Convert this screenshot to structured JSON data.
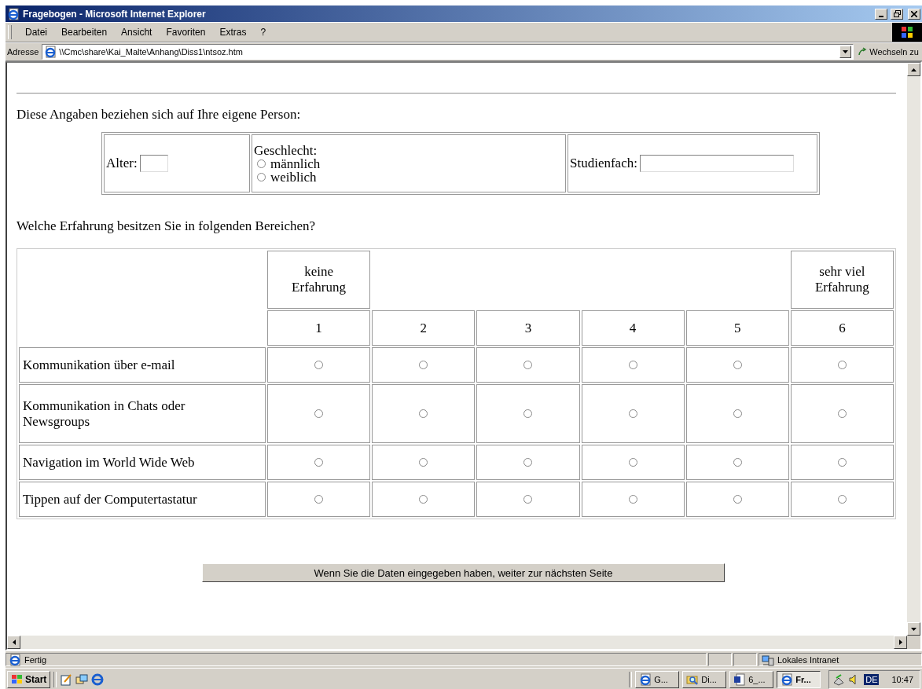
{
  "window": {
    "title": "Fragebogen - Microsoft Internet Explorer"
  },
  "menu": [
    "Datei",
    "Bearbeiten",
    "Ansicht",
    "Favoriten",
    "Extras",
    "?"
  ],
  "address_bar": {
    "label": "Adresse",
    "value": "\\\\Cmc\\share\\Kai_Malte\\Anhang\\Diss1\\ntsoz.htm",
    "go_button": "Wechseln zu"
  },
  "page": {
    "intro": "Diese Angaben beziehen sich auf Ihre eigene Person:",
    "age": {
      "label": "Alter:"
    },
    "gender": {
      "label": "Geschlecht:",
      "options": [
        {
          "label": "männlich",
          "selected": false
        },
        {
          "label": "weiblich",
          "selected": false
        }
      ]
    },
    "subject": {
      "label": "Studienfach:"
    },
    "question": "Welche Erfahrung besitzen Sie in folgenden Bereichen?",
    "scale": {
      "low_label": "keine Erfahrung",
      "high_label": "sehr viel Erfahrung",
      "columns": [
        "1",
        "2",
        "3",
        "4",
        "5",
        "6"
      ]
    },
    "rows": [
      {
        "label": "Kommunikation über e-mail",
        "options": [
          {
            "selected": false
          },
          {
            "selected": false
          },
          {
            "selected": false
          },
          {
            "selected": false
          },
          {
            "selected": false
          },
          {
            "selected": false
          }
        ]
      },
      {
        "label": "Kommunikation in Chats oder Newsgroups",
        "options": [
          {
            "selected": false
          },
          {
            "selected": false
          },
          {
            "selected": false
          },
          {
            "selected": false
          },
          {
            "selected": false
          },
          {
            "selected": false
          }
        ]
      },
      {
        "label": "Navigation im World Wide Web",
        "options": [
          {
            "selected": false
          },
          {
            "selected": false
          },
          {
            "selected": false
          },
          {
            "selected": false
          },
          {
            "selected": false
          },
          {
            "selected": false
          }
        ]
      },
      {
        "label": "Tippen auf der Computertastatur",
        "options": [
          {
            "selected": false
          },
          {
            "selected": false
          },
          {
            "selected": false
          },
          {
            "selected": false
          },
          {
            "selected": false
          },
          {
            "selected": false
          }
        ]
      }
    ],
    "submit": "Wenn Sie die Daten eingegeben haben, weiter zur nächsten Seite"
  },
  "status_bar": {
    "text": "Fertig",
    "zone": "Lokales Intranet"
  },
  "taskbar": {
    "start": "Start",
    "tasks": [
      {
        "label": "G...",
        "kind": "browser",
        "selected": false
      },
      {
        "label": "Di...",
        "kind": "explorer",
        "selected": false
      },
      {
        "label": "6_...",
        "kind": "word",
        "selected": false
      },
      {
        "label": "Fr...",
        "kind": "browser",
        "selected": true
      }
    ],
    "language": "DE",
    "clock": "10:47"
  }
}
